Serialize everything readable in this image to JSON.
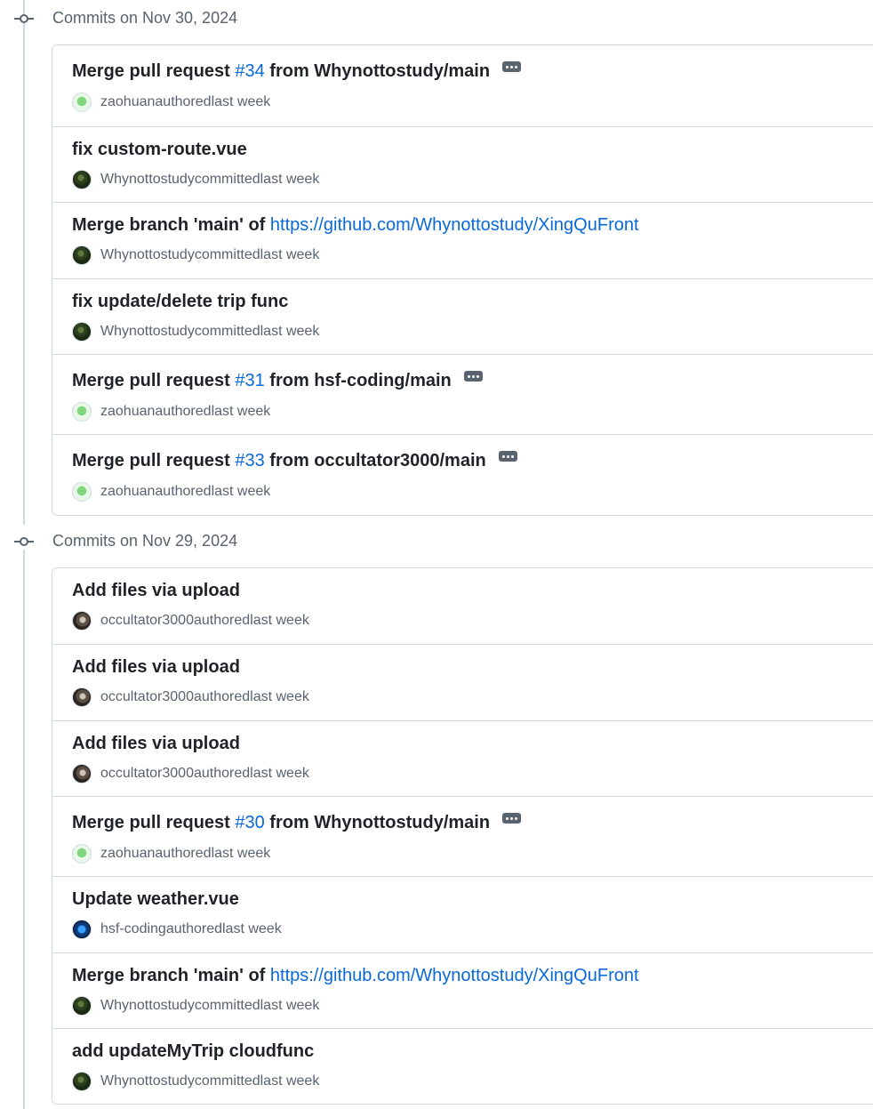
{
  "groups": [
    {
      "header": "Commits on Nov 30, 2024",
      "commits": [
        {
          "prefix": "Merge pull request ",
          "link": "#34",
          "suffix": " from Whynottostudy/main",
          "ellipsis": true,
          "user": "zaohuan",
          "action": "authored",
          "time": "last week",
          "avatar": "zaohuan"
        },
        {
          "prefix": "fix custom-route.vue",
          "link": "",
          "suffix": "",
          "ellipsis": false,
          "user": "Whynottostudy",
          "action": "committed",
          "time": "last week",
          "avatar": "why"
        },
        {
          "prefix": "Merge branch 'main' of ",
          "link": "https://github.com/Whynottostudy/XingQuFront",
          "suffix": "",
          "ellipsis": false,
          "user": "Whynottostudy",
          "action": "committed",
          "time": "last week",
          "avatar": "why"
        },
        {
          "prefix": "fix update/delete trip func",
          "link": "",
          "suffix": "",
          "ellipsis": false,
          "user": "Whynottostudy",
          "action": "committed",
          "time": "last week",
          "avatar": "why"
        },
        {
          "prefix": "Merge pull request ",
          "link": "#31",
          "suffix": " from hsf-coding/main",
          "ellipsis": true,
          "user": "zaohuan",
          "action": "authored",
          "time": "last week",
          "avatar": "zaohuan"
        },
        {
          "prefix": "Merge pull request ",
          "link": "#33",
          "suffix": " from occultator3000/main",
          "ellipsis": true,
          "user": "zaohuan",
          "action": "authored",
          "time": "last week",
          "avatar": "zaohuan"
        }
      ]
    },
    {
      "header": "Commits on Nov 29, 2024",
      "commits": [
        {
          "prefix": "Add files via upload",
          "link": "",
          "suffix": "",
          "ellipsis": false,
          "user": "occultator3000",
          "action": "authored",
          "time": "last week",
          "avatar": "occ"
        },
        {
          "prefix": "Add files via upload",
          "link": "",
          "suffix": "",
          "ellipsis": false,
          "user": "occultator3000",
          "action": "authored",
          "time": "last week",
          "avatar": "occ"
        },
        {
          "prefix": "Add files via upload",
          "link": "",
          "suffix": "",
          "ellipsis": false,
          "user": "occultator3000",
          "action": "authored",
          "time": "last week",
          "avatar": "occ"
        },
        {
          "prefix": "Merge pull request ",
          "link": "#30",
          "suffix": " from Whynottostudy/main",
          "ellipsis": true,
          "user": "zaohuan",
          "action": "authored",
          "time": "last week",
          "avatar": "zaohuan"
        },
        {
          "prefix": "Update weather.vue",
          "link": "",
          "suffix": "",
          "ellipsis": false,
          "user": "hsf-coding",
          "action": "authored",
          "time": "last week",
          "avatar": "hsf"
        },
        {
          "prefix": "Merge branch 'main' of ",
          "link": "https://github.com/Whynottostudy/XingQuFront",
          "suffix": "",
          "ellipsis": false,
          "user": "Whynottostudy",
          "action": "committed",
          "time": "last week",
          "avatar": "why"
        },
        {
          "prefix": "add updateMyTrip cloudfunc",
          "link": "",
          "suffix": "",
          "ellipsis": false,
          "user": "Whynottostudy",
          "action": "committed",
          "time": "last week",
          "avatar": "why"
        }
      ]
    }
  ]
}
